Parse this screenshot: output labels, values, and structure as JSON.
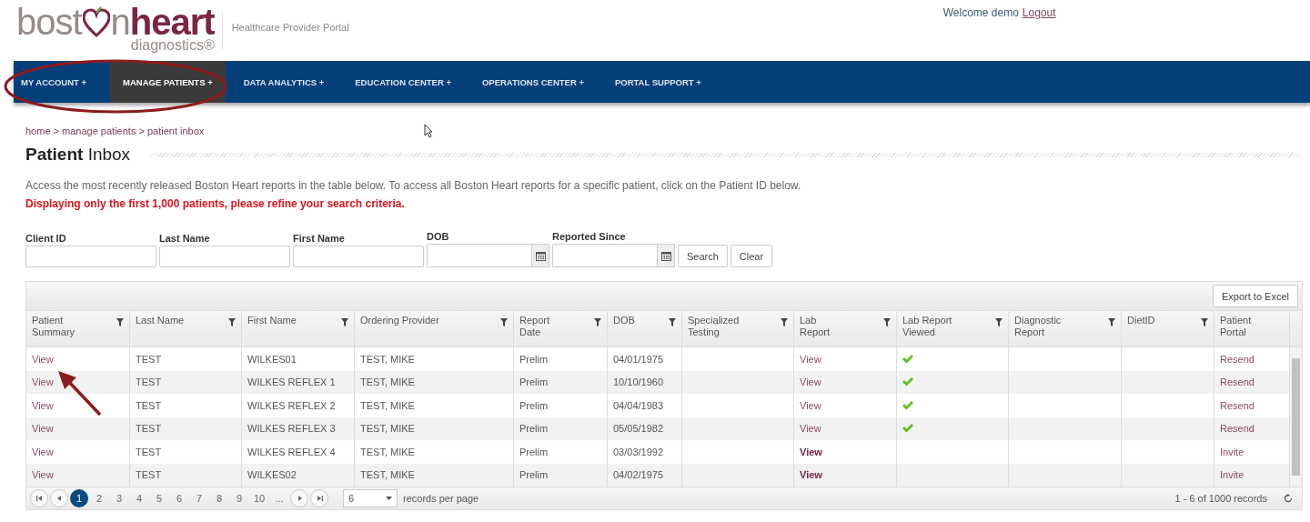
{
  "logo": {
    "first": "bost",
    "second": "n",
    "strong": "heart",
    "sub": "diagnostics®"
  },
  "portal_title": "Healthcare Provider Portal",
  "welcome": {
    "text": "Welcome demo",
    "link": "Logout"
  },
  "nav": [
    {
      "label": "MY ACCOUNT +",
      "selected": false
    },
    {
      "label": "MANAGE PATIENTS +",
      "selected": true
    },
    {
      "label": "DATA ANALYTICS +",
      "selected": false
    },
    {
      "label": "EDUCATION CENTER +",
      "selected": false
    },
    {
      "label": "OPERATIONS CENTER +",
      "selected": false
    },
    {
      "label": "PORTAL SUPPORT +",
      "selected": false
    }
  ],
  "breadcrumb": "home > manage patients > patient inbox",
  "page_title": "**Patient** Inbox",
  "intro": "Access the most recently released Boston Heart reports in the table below. To access all Boston Heart reports for a specific patient, click on the Patient ID below.",
  "warning": "Displaying only the first 1,000 patients, please refine your search criteria.",
  "filters": [
    {
      "label": "Client ID",
      "kind": "text"
    },
    {
      "label": "Last Name",
      "kind": "text"
    },
    {
      "label": "First Name",
      "kind": "text"
    },
    {
      "label": "DOB",
      "kind": "date"
    },
    {
      "label": "Reported Since",
      "kind": "date"
    }
  ],
  "buttons": [
    "Search",
    "Clear"
  ],
  "export_button": "Export to Excel",
  "columns": [
    {
      "label": "Patient Summary",
      "filter": true
    },
    {
      "label": "Last Name",
      "filter": true
    },
    {
      "label": "First Name",
      "filter": true
    },
    {
      "label": "Ordering Provider",
      "filter": true
    },
    {
      "label": "Report Date",
      "filter": true
    },
    {
      "label": "DOB",
      "filter": true
    },
    {
      "label": "Specialized Testing",
      "filter": true
    },
    {
      "label": "Lab Report",
      "filter": true
    },
    {
      "label": "Lab Report Viewed",
      "filter": true
    },
    {
      "label": "Diagnostic Report",
      "filter": true
    },
    {
      "label": "DietID",
      "filter": true
    },
    {
      "label": "Patient Portal",
      "filter": false
    }
  ],
  "rows": [
    {
      "summary": "View",
      "last_name": "TEST",
      "first_name": "WILKES01",
      "provider": "TEST, MIKE",
      "report_date": "Prelim",
      "dob": "04/01/1975",
      "lab_report": "View",
      "lab_report_new": false,
      "viewed": true,
      "portal": "Resend"
    },
    {
      "summary": "View",
      "last_name": "TEST",
      "first_name": "WILKES REFLEX 1",
      "provider": "TEST, MIKE",
      "report_date": "Prelim",
      "dob": "10/10/1960",
      "lab_report": "View",
      "lab_report_new": false,
      "viewed": true,
      "portal": "Resend"
    },
    {
      "summary": "View",
      "last_name": "TEST",
      "first_name": "WILKES REFLEX 2",
      "provider": "TEST, MIKE",
      "report_date": "Prelim",
      "dob": "04/04/1983",
      "lab_report": "View",
      "lab_report_new": false,
      "viewed": true,
      "portal": "Resend"
    },
    {
      "summary": "View",
      "last_name": "TEST",
      "first_name": "WILKES REFLEX 3",
      "provider": "TEST, MIKE",
      "report_date": "Prelim",
      "dob": "05/05/1982",
      "lab_report": "View",
      "lab_report_new": false,
      "viewed": true,
      "portal": "Resend"
    },
    {
      "summary": "View",
      "last_name": "TEST",
      "first_name": "WILKES REFLEX 4",
      "provider": "TEST, MIKE",
      "report_date": "Prelim",
      "dob": "03/03/1992",
      "lab_report": "View",
      "lab_report_new": true,
      "viewed": false,
      "portal": "Invite"
    },
    {
      "summary": "View",
      "last_name": "TEST",
      "first_name": "WILKES02",
      "provider": "TEST, MIKE",
      "report_date": "Prelim",
      "dob": "04/02/1975",
      "lab_report": "View",
      "lab_report_new": true,
      "viewed": false,
      "portal": "Invite"
    }
  ],
  "pager": {
    "pages": [
      {
        "label": "1",
        "selected": true
      },
      {
        "label": "2",
        "selected": false
      },
      {
        "label": "3",
        "selected": false
      },
      {
        "label": "4",
        "selected": false
      },
      {
        "label": "5",
        "selected": false
      },
      {
        "label": "6",
        "selected": false
      },
      {
        "label": "7",
        "selected": false
      },
      {
        "label": "8",
        "selected": false
      },
      {
        "label": "9",
        "selected": false
      },
      {
        "label": "10",
        "selected": false
      }
    ],
    "more": "...",
    "page_size": "6",
    "page_size_label": "records per page",
    "summary": "1 - 6 of 1000 records"
  }
}
